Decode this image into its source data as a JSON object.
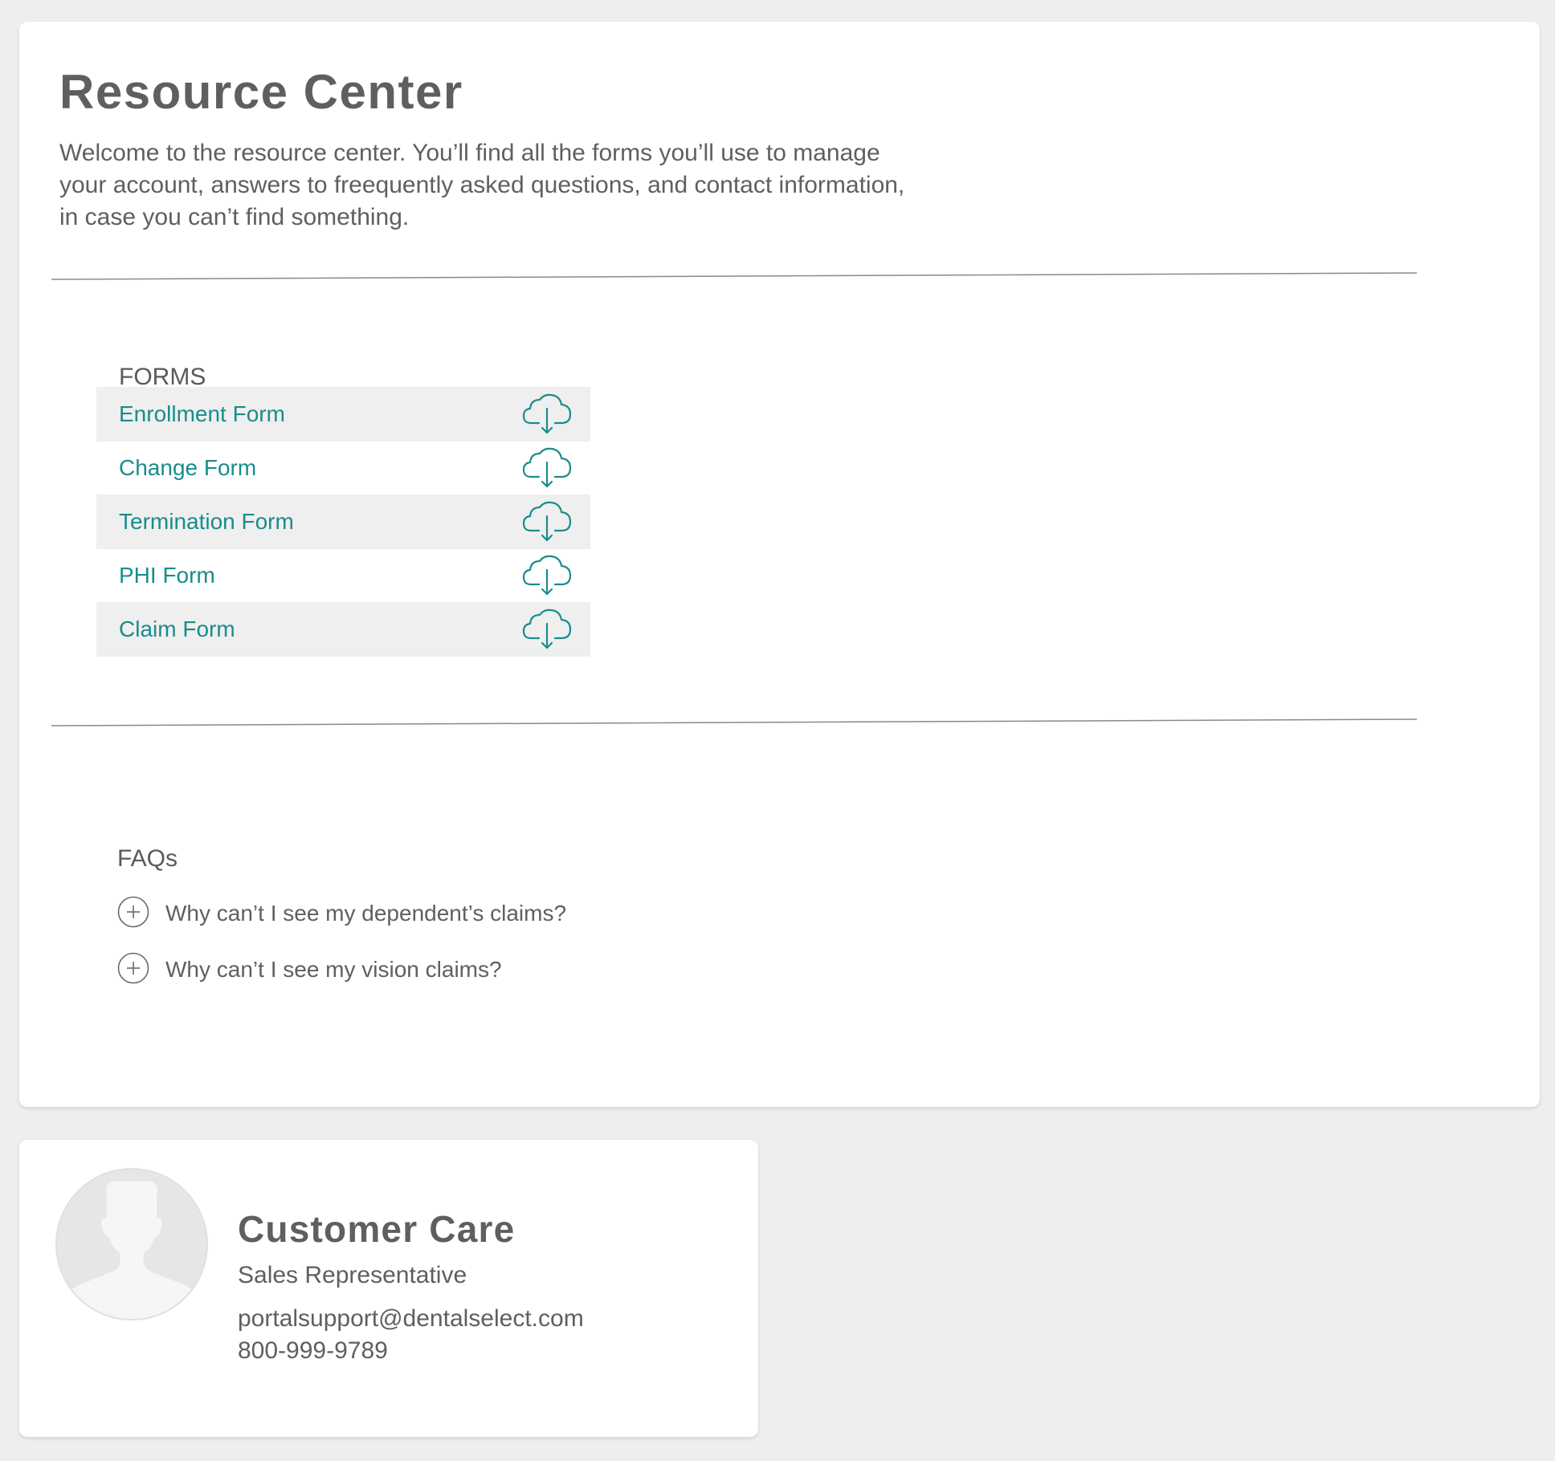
{
  "resource_center": {
    "title": "Resource Center",
    "intro": "Welcome to the resource center. You’ll find all the forms you’ll use to manage your account, answers to freequently asked questions, and contact information, in case you can’t find something."
  },
  "forms": {
    "heading": "FORMS",
    "download_icon": "cloud-download-icon",
    "items": [
      {
        "label": "Enrollment Form"
      },
      {
        "label": "Change Form"
      },
      {
        "label": "Termination Form"
      },
      {
        "label": "PHI Form"
      },
      {
        "label": "Claim Form"
      }
    ]
  },
  "faqs": {
    "heading": "FAQs",
    "expand_icon": "plus-circle-icon",
    "items": [
      {
        "question": "Why can’t I see my dependent’s claims?"
      },
      {
        "question": "Why can’t I see my vision claims?"
      }
    ]
  },
  "contact": {
    "avatar_icon": "user-silhouette-icon",
    "name": "Customer Care",
    "role": "Sales Representative",
    "email": "portalsupport@dentalselect.com",
    "phone": "800-999-9789"
  },
  "colors": {
    "background": "#eeeeee",
    "card": "#ffffff",
    "accent": "#1a8c8c",
    "text": "#5f5f5f",
    "row_stripe": "#efefef"
  }
}
